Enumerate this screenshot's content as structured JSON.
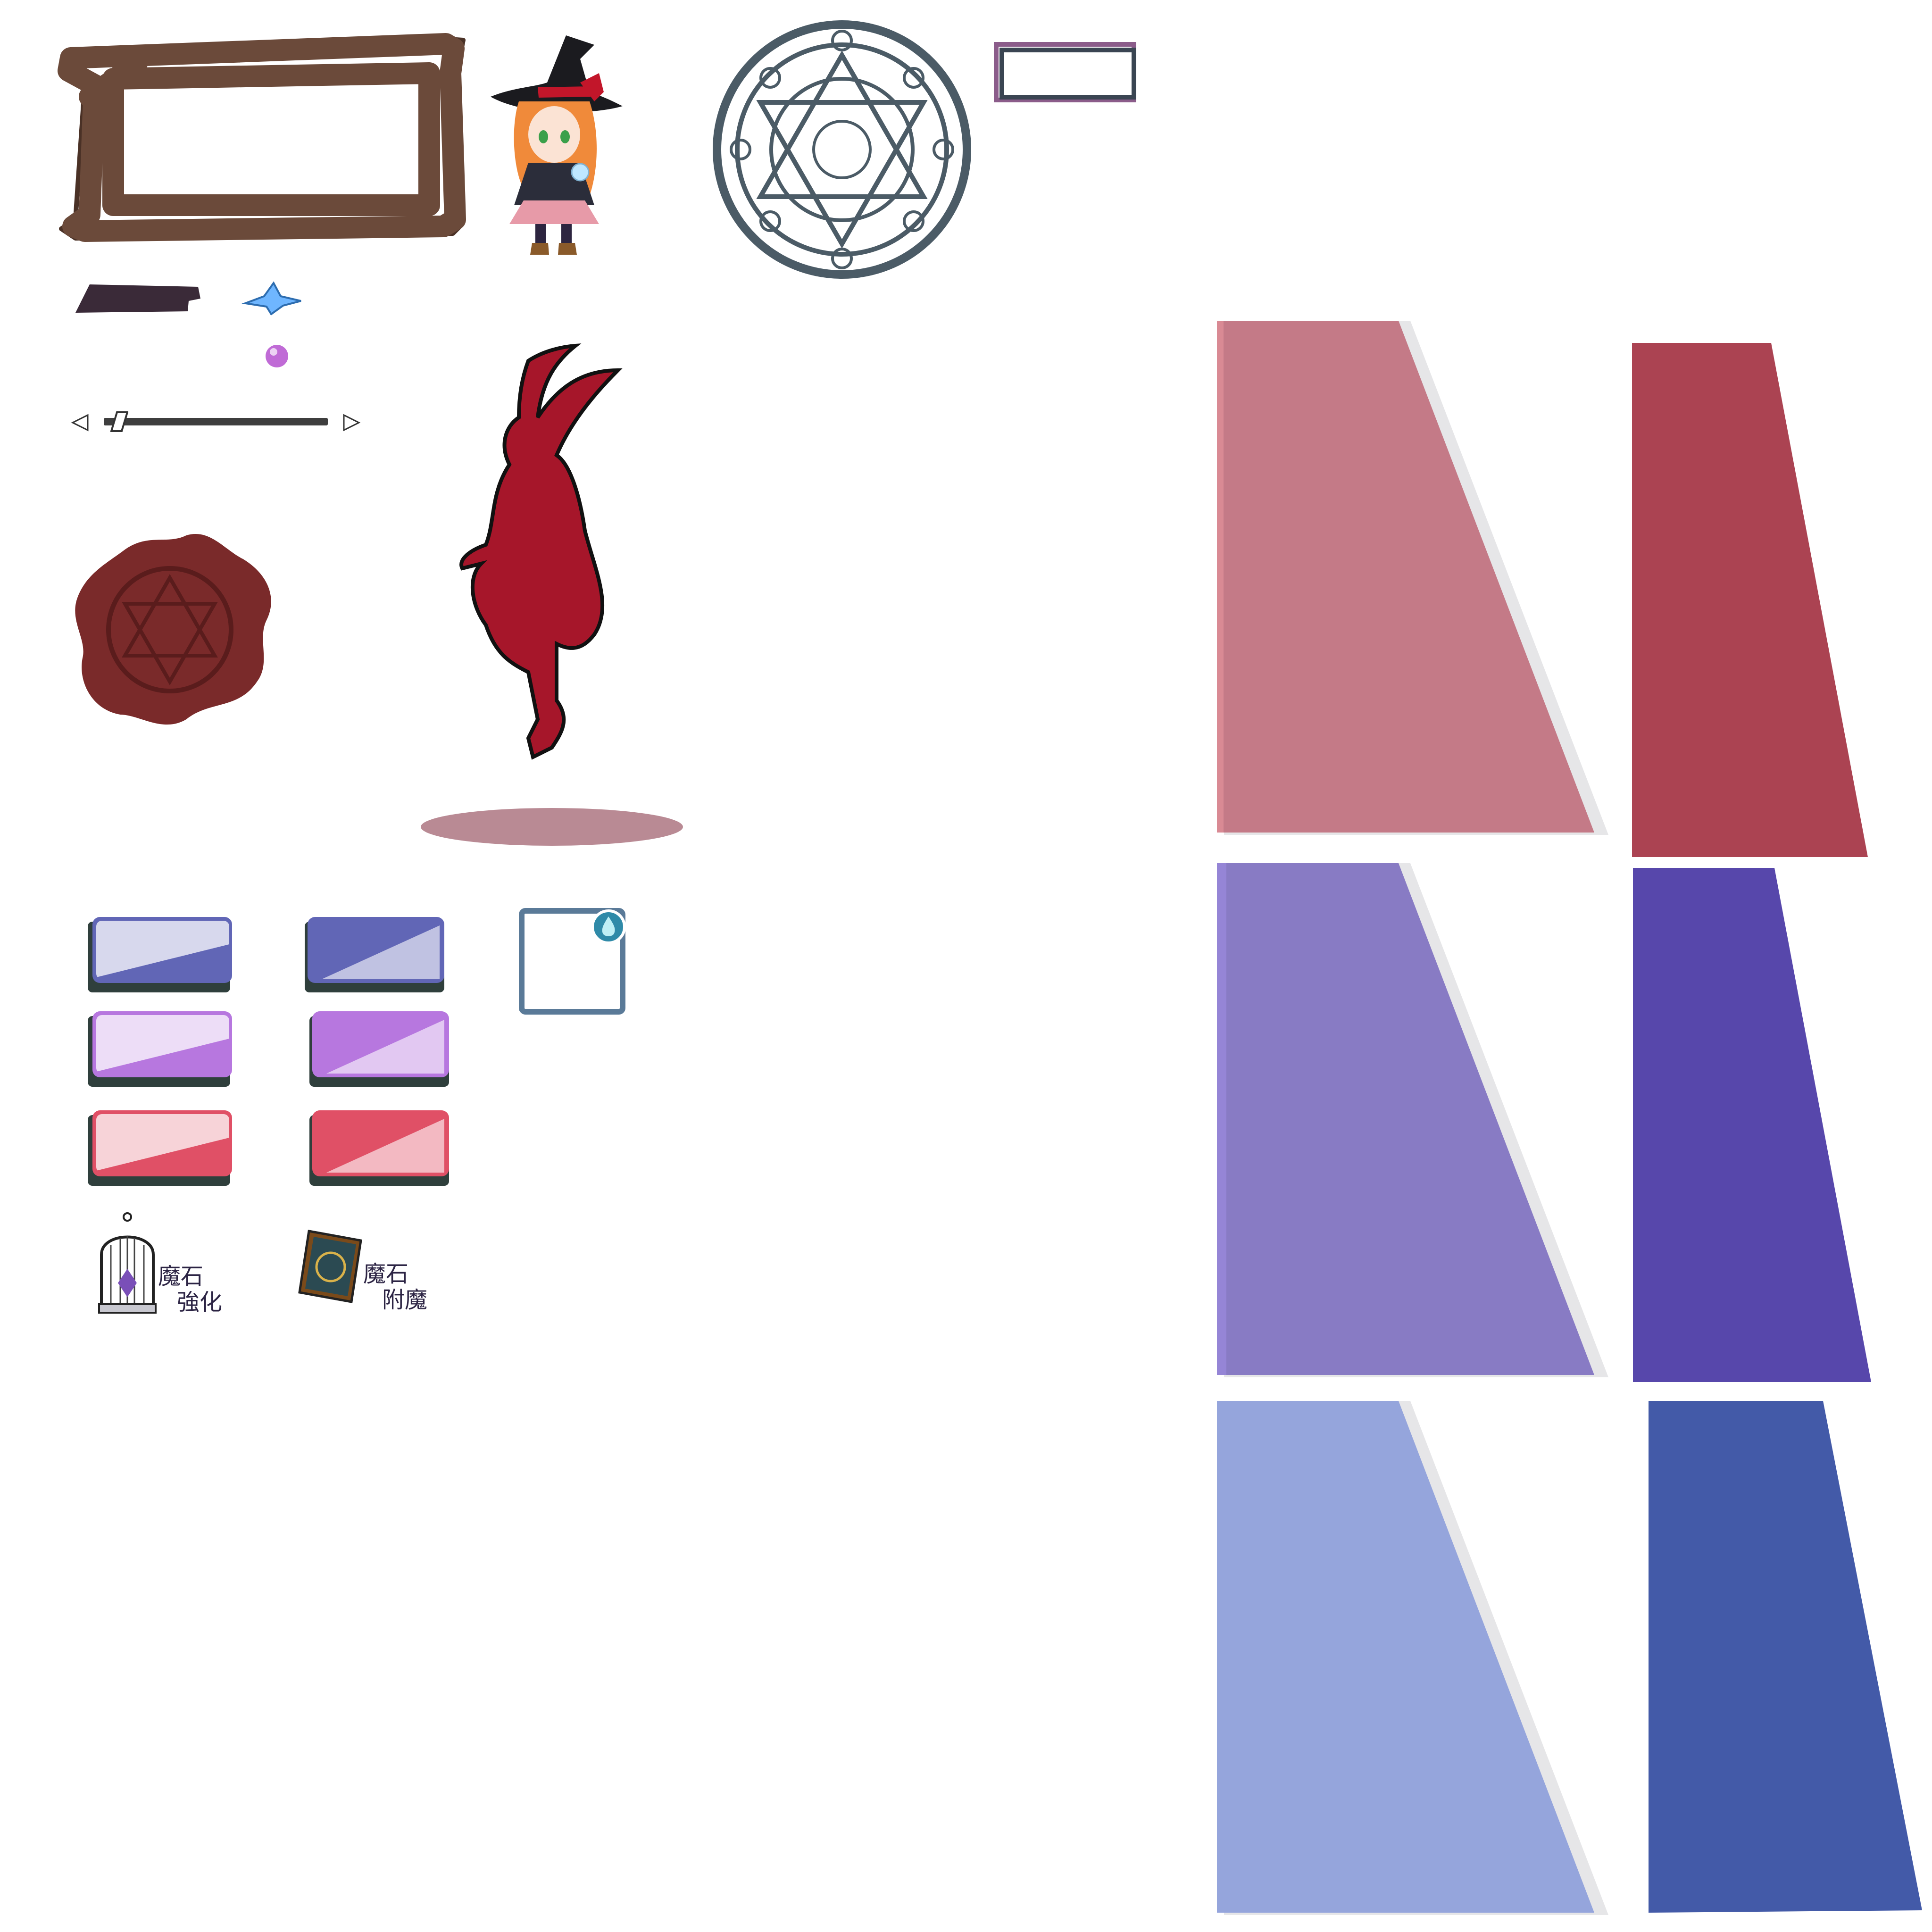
{
  "atlas": {
    "background": "#ffffff"
  },
  "frame": {
    "color": "#4a3126",
    "highlight": "#6b4a3a"
  },
  "witch": {
    "hat": "#1b1b1f",
    "hair": "#f08a3a",
    "ribbon": "#c2162a",
    "dress": "#e79aa8",
    "cloak": "#2b2d3a"
  },
  "magic_circle": {
    "color": "#4b5b66"
  },
  "mini_frame": {
    "outer": "#8b5c8a",
    "inner": "#3a4552"
  },
  "status_bar": {
    "color": "#3a2a38"
  },
  "crystal_icon": {
    "color": "#6fb6ff"
  },
  "orb_icon": {
    "color": "#c06bd6"
  },
  "slider": {
    "track_color": "#3e3e3e",
    "value_fraction": 0.05
  },
  "wax_seal": {
    "color": "#7a2a2a",
    "emblem": "#5a1c1c"
  },
  "silhouette": {
    "color": "#a6162a",
    "outline": "#111111",
    "shadow": "#b98a94"
  },
  "tabs": [
    {
      "name": "tab-blue-inactive",
      "accent": "#6166b6"
    },
    {
      "name": "tab-blue-active",
      "accent": "#6166b6"
    },
    {
      "name": "tab-purple-inactive",
      "accent": "#b777df"
    },
    {
      "name": "tab-purple-active",
      "accent": "#b777df"
    },
    {
      "name": "tab-red-inactive",
      "accent": "#e05066"
    },
    {
      "name": "tab-red-active",
      "accent": "#e05066"
    }
  ],
  "slot_frame": {
    "border": "#5a7a98",
    "icon": "#2f8aa8"
  },
  "menu_buttons": [
    {
      "line1": "魔石",
      "line2": "強化",
      "icon": "birdcage-icon"
    },
    {
      "line1": "魔石",
      "line2": "附魔",
      "icon": "spellbook-icon"
    }
  ],
  "panels": [
    {
      "color": "#c47a87",
      "edge": "#d98a94",
      "shade": "#e6e6e8"
    },
    {
      "color": "#ab4352",
      "shade": "#ffffff"
    },
    {
      "color": "#887bc4",
      "edge": "#9585d6",
      "shade": "#e6e6e8"
    },
    {
      "color": "#5747ab",
      "shade": "#ffffff"
    },
    {
      "color": "#95a5dc",
      "edge": "#a2b0e6",
      "shade": "#e6e6e8"
    },
    {
      "color": "#435aa8",
      "shade": "#ffffff"
    }
  ]
}
